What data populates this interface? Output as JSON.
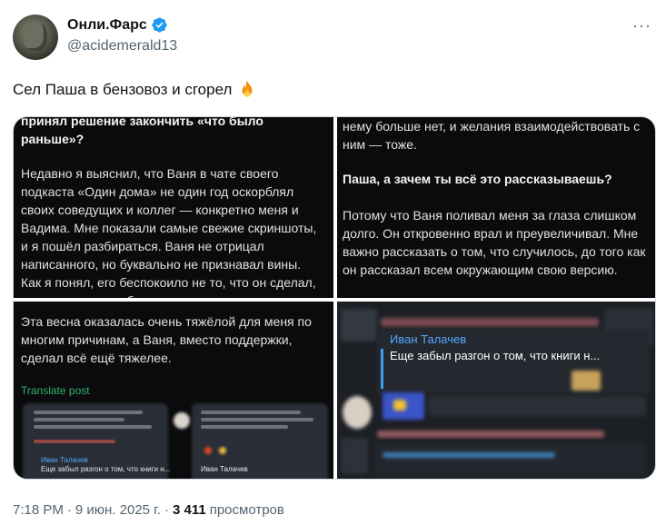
{
  "author": {
    "display_name": "Онли.Фарс",
    "handle": "@acidemerald13",
    "avatar_icon": "avatar-image",
    "verified_icon": "verified-badge-icon",
    "verified_color": "#1d9bf0"
  },
  "more_label": "···",
  "tweet": {
    "text": "Сел Паша в бензовоз и сгорел",
    "emoji_icon": "fire-emoji-icon"
  },
  "media": {
    "tile1": {
      "heading": "принял решение закончить «что было раньше»?",
      "paragraph": "Недавно я выяснил, что Ваня в чате своего подкаста «Один дома» не один год оскорблял своих соведущих и коллег — конкретно меня и Вадима. Мне показали самые свежие скриншоты, и я пошёл разбираться. Ваня не отрицал написанного, но буквально не признавал вины. Как я понял, его беспокоило не то, что он сделал, а лишь то, что я об этом узнал."
    },
    "tile2": {
      "top_text": "нему больше нет, и желания взаимодействовать с ним — тоже.",
      "question": "Паша, а зачем ты всё это рассказываешь?",
      "answer": "Потому что Ваня поливал меня за глаза слишком долго. Он откровенно врал и преувеличивал. Мне важно рассказать о том, что случилось, до того как он рассказал всем окружающим свою версию."
    },
    "tile3": {
      "paragraph": "Эта весна оказалась очень тяжёлой для меня по многим причинам, а Ваня, вместо поддержки, сделал всё ещё тяжелее.",
      "translate_label": "Translate post",
      "mini_name_left": "Иван Талачев",
      "mini_quote_left": "Еще забыл разгон о том, что книги н...",
      "mini_name_right": "Иван Талачев"
    },
    "tile4": {
      "quote_name": "Иван Талачев",
      "quote_text": "Еще забыл разгон о том, что книги н..."
    }
  },
  "footer": {
    "time": "7:18 PM",
    "dot1": "·",
    "date": "9 июн. 2025 г.",
    "dot2": "·",
    "views_count": "3 411",
    "views_label": "просмотров"
  }
}
